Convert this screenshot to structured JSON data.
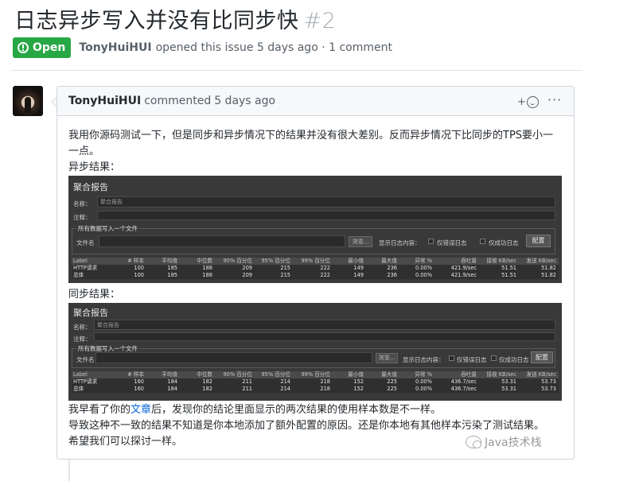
{
  "issue": {
    "title": "日志异步写入并没有比同步快",
    "number": "#2",
    "state": "Open",
    "author": "TonyHuiHUI",
    "opened_text": "opened this issue 5 days ago · 1 comment"
  },
  "comment": {
    "author": "TonyHuiHUI",
    "action": "commented",
    "time": "5 days ago",
    "reaction_plus": "+",
    "more": "···",
    "line1": "我用你源码测试一下，但是同步和异步情况下的结果并没有很大差别。反而异步情况下比同步的TPS要小一",
    "line2": "一点。",
    "async_label": "异步结果：",
    "sync_label": "同步结果：",
    "footer1_pre": "我早看了你的",
    "footer1_link": "文章",
    "footer1_post": "后，发现你的结论里面显示的两次结果的使用样本数是不一样。",
    "footer2": "导致这种不一致的结果不知道是你本地添加了额外配置的原因。还是你本地有其他样本污染了测试结果。",
    "footer3": "希望我们可以探讨一样。"
  },
  "jmeter_async": {
    "title": "聚合报告",
    "name_label": "名称：",
    "name_value": "聚合报告",
    "comment_label": "注释：",
    "group_title": "所有数据写入一个文件",
    "file_label": "文件名",
    "browse": "浏览...",
    "log_label": "显示日志内容：",
    "errors_only": "仅错误日志",
    "success_only": "仅成功日志",
    "config": "配置",
    "headers": [
      "Label",
      "# 样本",
      "平均值",
      "中位数",
      "90% 百分位",
      "95% 百分位",
      "99% 百分位",
      "最小值",
      "最大值",
      "异常 %",
      "吞吐量",
      "接收 KB/sec",
      "发送 KB/sec"
    ],
    "rows": [
      [
        "HTTP请求",
        "100",
        "185",
        "188",
        "209",
        "215",
        "222",
        "149",
        "236",
        "0.00%",
        "421.9/sec",
        "51.51",
        "51.82"
      ],
      [
        "总体",
        "100",
        "185",
        "188",
        "209",
        "215",
        "222",
        "149",
        "236",
        "0.00%",
        "421.9/sec",
        "51.51",
        "51.82"
      ]
    ]
  },
  "jmeter_sync": {
    "title": "聚合报告",
    "name_label": "名称：",
    "name_value": "聚合报告",
    "comment_label": "注释：",
    "group_title": "所有数据写入一个文件",
    "file_label": "文件名",
    "browse": "浏览...",
    "log_label": "显示日志内容：",
    "errors_only": "仅错误日志",
    "success_only": "仅成功日志",
    "config": "配置",
    "headers": [
      "Label",
      "# 样本",
      "平均值",
      "中位数",
      "90% 百分位",
      "95% 百分位",
      "99% 百分位",
      "最小值",
      "最大值",
      "异常 %",
      "吞吐量",
      "接收 KB/sec",
      "发送 KB/sec"
    ],
    "rows": [
      [
        "HTTP请求",
        "160",
        "184",
        "182",
        "211",
        "214",
        "218",
        "152",
        "225",
        "0.00%",
        "436.7/sec",
        "53.31",
        "53.73"
      ],
      [
        "总体",
        "160",
        "184",
        "182",
        "211",
        "214",
        "218",
        "152",
        "225",
        "0.00%",
        "436.7/sec",
        "53.31",
        "53.73"
      ]
    ]
  },
  "watermark": "Java技术栈"
}
